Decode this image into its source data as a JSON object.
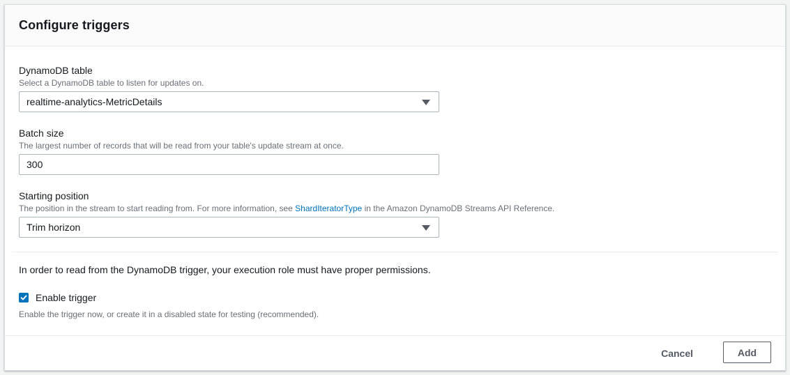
{
  "panel": {
    "title": "Configure triggers"
  },
  "dynamodb_table": {
    "label": "DynamoDB table",
    "description": "Select a DynamoDB table to listen for updates on.",
    "value": "realtime-analytics-MetricDetails"
  },
  "batch_size": {
    "label": "Batch size",
    "description": "The largest number of records that will be read from your table's update stream at once.",
    "value": "300"
  },
  "starting_position": {
    "label": "Starting position",
    "description_prefix": "The position in the stream to start reading from. For more information, see ",
    "link_text": "ShardIteratorType",
    "description_suffix": " in the Amazon DynamoDB Streams API Reference.",
    "value": "Trim horizon"
  },
  "permissions_note": "In order to read from the DynamoDB trigger, your execution role must have proper permissions.",
  "enable_trigger": {
    "label": "Enable trigger",
    "checked": true,
    "description": "Enable the trigger now, or create it in a disabled state for testing (recommended)."
  },
  "footer": {
    "cancel_label": "Cancel",
    "add_label": "Add"
  },
  "colors": {
    "accent": "#0073bb",
    "link": "#0073bb",
    "border": "#aab7b8"
  },
  "icons": {
    "select_caret": "caret-down-icon",
    "checkbox_check": "check-icon"
  }
}
